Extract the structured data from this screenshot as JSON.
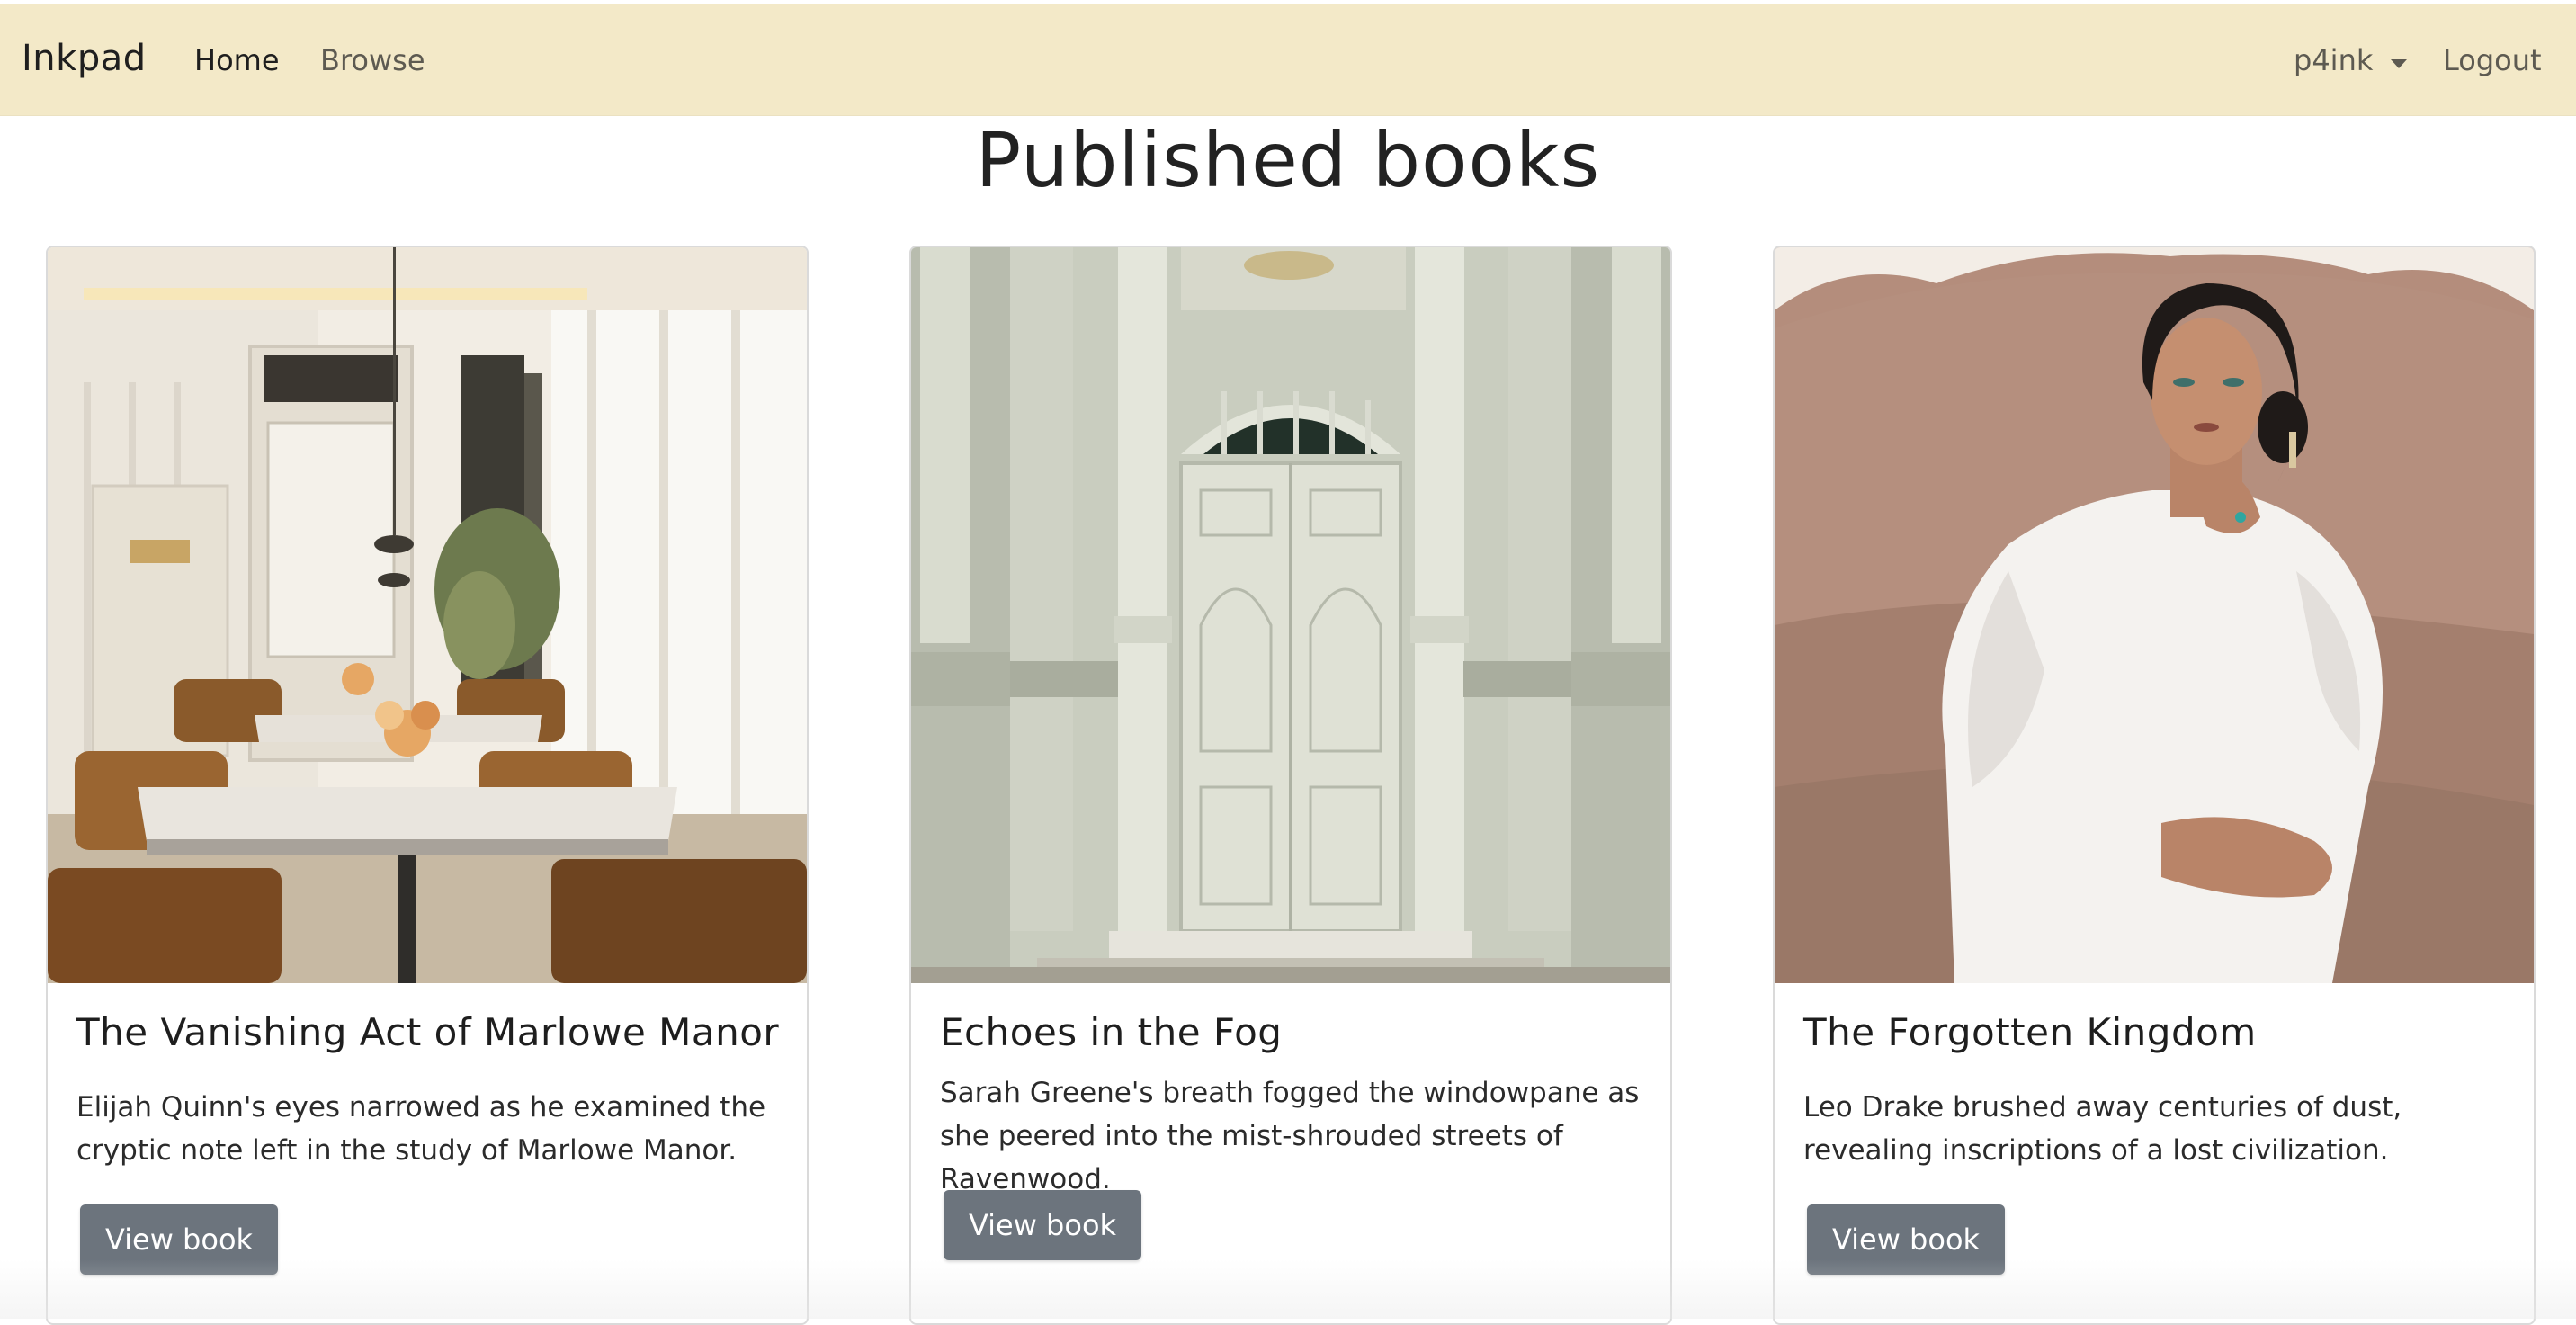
{
  "navbar": {
    "brand": "Inkpad",
    "links": [
      "Home",
      "Browse"
    ],
    "user": "p4ink",
    "logout": "Logout",
    "background": "#f3e9c8"
  },
  "page": {
    "title": "Published books"
  },
  "books": [
    {
      "title": "The Vanishing Act of Marlowe Manor",
      "excerpt": "Elijah Quinn's eyes narrowed as he examined the cryptic note left in the study of Marlowe Manor.",
      "button": "View book"
    },
    {
      "title": "Echoes in the Fog",
      "excerpt": "Sarah Greene's breath fogged the windowpane as she peered into the mist-shrouded streets of Ravenwood.",
      "button": "View book"
    },
    {
      "title": "The Forgotten Kingdom",
      "excerpt": "Leo Drake brushed away centuries of dust, revealing inscriptions of a lost civilization.",
      "button": "View book"
    }
  ],
  "colors": {
    "button": "#6c747d",
    "card_border": "#dadada"
  }
}
